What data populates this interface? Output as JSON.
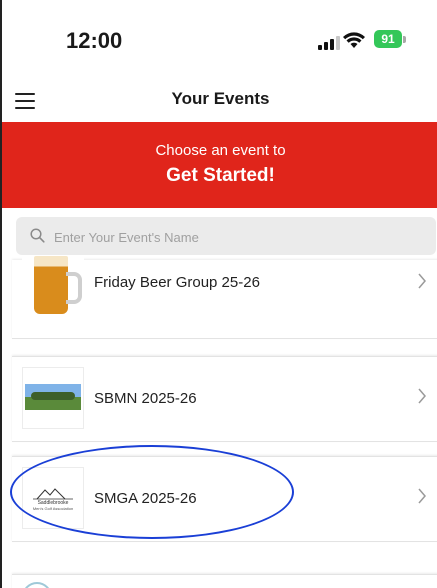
{
  "status_bar": {
    "time": "12:00",
    "battery": "91",
    "icons": [
      "signal-icon",
      "wifi-icon",
      "battery-icon"
    ]
  },
  "nav": {
    "title": "Your Events",
    "menu_icon": "hamburger-menu-icon"
  },
  "hero": {
    "line1": "Choose an event to",
    "line2": "Get Started!",
    "background": "#e0251b"
  },
  "search": {
    "placeholder": "Enter Your Event's Name",
    "value": "",
    "icon": "search-icon"
  },
  "events": [
    {
      "name": "Friday Beer Group 25-26",
      "thumb": "beer-mug-image"
    },
    {
      "name": "SBMN 2025-26",
      "thumb": "golf-course-photo"
    },
    {
      "name": "SMGA 2025-26",
      "thumb": "smga-logo",
      "logo_caption_1": "Saddlebrooke",
      "logo_caption_2": "Men's Golf Association"
    }
  ],
  "annotation": {
    "shape": "oval",
    "color": "#1a3fd6"
  }
}
